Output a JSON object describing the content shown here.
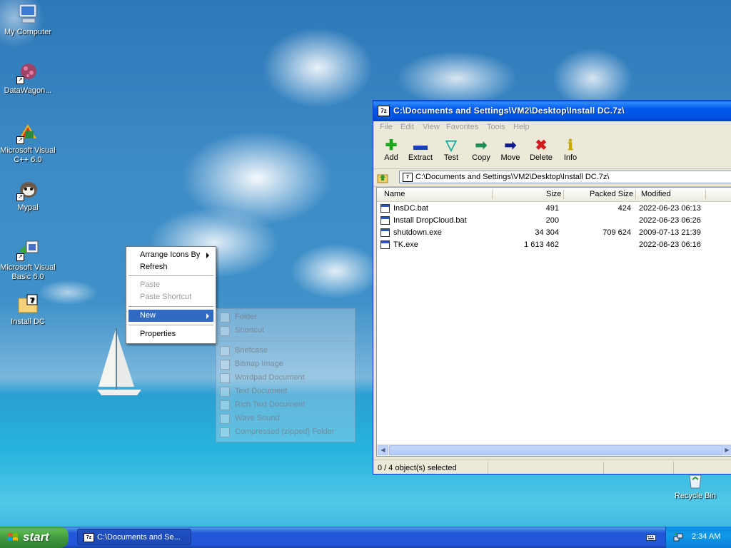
{
  "desktop": {
    "icons": [
      {
        "label": "My Computer",
        "icon": "my-computer-icon"
      },
      {
        "label": "DataWagon...",
        "icon": "datawagon-icon"
      },
      {
        "label": "Microsoft Visual C++ 6.0",
        "icon": "visual-cpp-icon"
      },
      {
        "label": "Mypal",
        "icon": "mypal-icon"
      },
      {
        "label": "Microsoft Visual Basic 6.0",
        "icon": "visual-basic-icon"
      },
      {
        "label": "Install DC",
        "icon": "7z-archive-icon"
      },
      {
        "label": "Recycle Bin",
        "icon": "recycle-bin-icon"
      }
    ]
  },
  "context_menu": {
    "items": [
      {
        "label": "Arrange Icons By",
        "submenu": true,
        "enabled": true
      },
      {
        "label": "Refresh",
        "enabled": true
      },
      {
        "label": "Paste",
        "enabled": false
      },
      {
        "label": "Paste Shortcut",
        "enabled": false
      },
      {
        "label": "New",
        "submenu": true,
        "enabled": true,
        "selected": true
      },
      {
        "label": "Properties",
        "enabled": true
      }
    ],
    "new_submenu": [
      "Folder",
      "Shortcut",
      "Briefcase",
      "Bitmap Image",
      "Wordpad Document",
      "Text Document",
      "Rich Text Document",
      "Wave Sound",
      "Compressed (zipped) Folder"
    ]
  },
  "window": {
    "title": "C:\\Documents and Settings\\VM2\\Desktop\\Install DC.7z\\",
    "app_icon": "7z",
    "menu": [
      "File",
      "Edit",
      "View",
      "Favorites",
      "Tools",
      "Help"
    ],
    "toolbar": [
      {
        "label": "Add",
        "icon": "add-icon",
        "color": "#1aa41a"
      },
      {
        "label": "Extract",
        "icon": "extract-icon",
        "color": "#1b3fb8"
      },
      {
        "label": "Test",
        "icon": "test-icon",
        "color": "#1aa8a0"
      },
      {
        "label": "Copy",
        "icon": "copy-icon",
        "color": "#1f8f5a"
      },
      {
        "label": "Move",
        "icon": "move-icon",
        "color": "#101b8f"
      },
      {
        "label": "Delete",
        "icon": "delete-icon",
        "color": "#d21a1a"
      },
      {
        "label": "Info",
        "icon": "info-icon",
        "color": "#c8a800"
      }
    ],
    "address": "C:\\Documents and Settings\\VM2\\Desktop\\Install DC.7z\\",
    "columns": [
      "Name",
      "Size",
      "Packed Size",
      "Modified"
    ],
    "files": [
      {
        "name": "InsDC.bat",
        "size": "491",
        "packed": "424",
        "modified": "2022-06-23 06:13"
      },
      {
        "name": "Install DropCloud.bat",
        "size": "200",
        "packed": "",
        "modified": "2022-06-23 06:26"
      },
      {
        "name": "shutdown.exe",
        "size": "34 304",
        "packed": "709 624",
        "modified": "2009-07-13 21:39"
      },
      {
        "name": "TK.exe",
        "size": "1 613 462",
        "packed": "",
        "modified": "2022-06-23 06:16"
      }
    ],
    "status": "0 / 4 object(s) selected"
  },
  "taskbar": {
    "start_label": "start",
    "task_title": "C:\\Documents and Se...",
    "clock": "2:34 AM"
  }
}
